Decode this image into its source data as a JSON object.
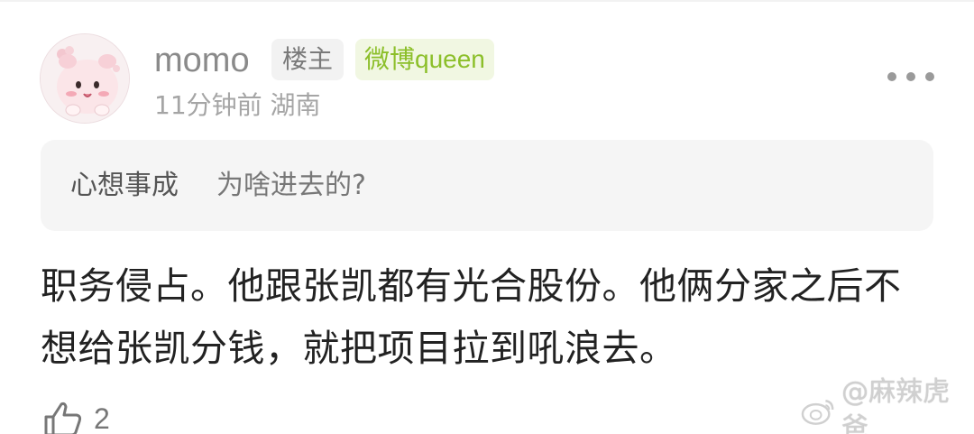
{
  "comment": {
    "username": "momo",
    "owner_badge": "楼主",
    "title_badge": "微博queen",
    "meta": "11分钟前 湖南",
    "quote": {
      "user": "心想事成",
      "text": "为啥进去的?"
    },
    "body": "职务侵占。他跟张凯都有光合股份。他俩分家之后不想给张凯分钱，就把项目拉到吼浪去。",
    "like_count": "2"
  },
  "watermark": {
    "text": "@麻辣虎爸"
  },
  "colors": {
    "queen_badge": "#8cbf2a",
    "quote_bg": "#f5f5f5"
  },
  "icons": [
    "avatar",
    "more-icon",
    "thumbs-up-icon",
    "weibo-logo-icon"
  ]
}
